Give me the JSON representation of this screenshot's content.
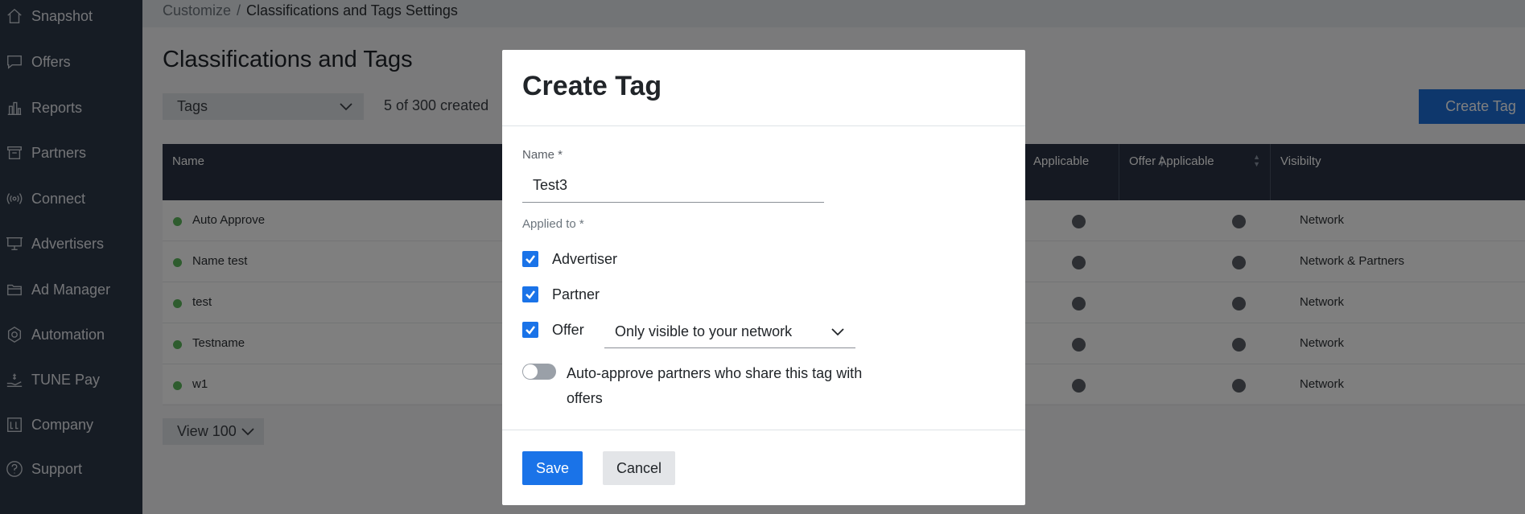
{
  "sidebar": {
    "items": [
      {
        "label": "Snapshot",
        "icon": "home-icon"
      },
      {
        "label": "Offers",
        "icon": "chat-icon"
      },
      {
        "label": "Reports",
        "icon": "bar-chart-icon"
      },
      {
        "label": "Partners",
        "icon": "partners-icon"
      },
      {
        "label": "Connect",
        "icon": "broadcast-icon"
      },
      {
        "label": "Advertisers",
        "icon": "billboard-icon"
      },
      {
        "label": "Ad Manager",
        "icon": "folder-icon"
      },
      {
        "label": "Automation",
        "icon": "gear-icon"
      },
      {
        "label": "TUNE Pay",
        "icon": "pay-icon"
      },
      {
        "label": "Company",
        "icon": "company-icon"
      },
      {
        "label": "Support",
        "icon": "help-icon"
      }
    ]
  },
  "breadcrumb": {
    "parent": "Customize",
    "separator": "/",
    "current": "Classifications and Tags Settings"
  },
  "page": {
    "title": "Classifications and Tags",
    "filter_value": "Tags",
    "created_count": "5 of 300 created",
    "create_button": "Create Tag",
    "view_button": "View 100"
  },
  "table": {
    "headers": {
      "name": "Name",
      "partner_applicable": "Applicable",
      "offer_applicable": "Offer Applicable",
      "visibility": "Visibilty"
    },
    "rows": [
      {
        "name": "Auto Approve",
        "visibility": "Network"
      },
      {
        "name": "Name test",
        "visibility": "Network & Partners"
      },
      {
        "name": "test",
        "visibility": "Network"
      },
      {
        "name": "Testname",
        "visibility": "Network"
      },
      {
        "name": "w1",
        "visibility": "Network"
      }
    ]
  },
  "modal": {
    "title": "Create Tag",
    "name_label": "Name *",
    "name_value": "Test3",
    "applied_label": "Applied to *",
    "options": {
      "advertiser": {
        "label": "Advertiser",
        "checked": true
      },
      "partner": {
        "label": "Partner",
        "checked": true
      },
      "offer": {
        "label": "Offer",
        "checked": true
      }
    },
    "offer_visibility": "Only visible to your network",
    "auto_approve_label": "Auto-approve partners who share this tag with offers",
    "auto_approve_on": false,
    "save_button": "Save",
    "cancel_button": "Cancel"
  },
  "colors": {
    "sidebar_bg": "#2d3848",
    "primary": "#1a73e8",
    "status_green": "#5cb85c",
    "table_header": "#2a3344"
  }
}
